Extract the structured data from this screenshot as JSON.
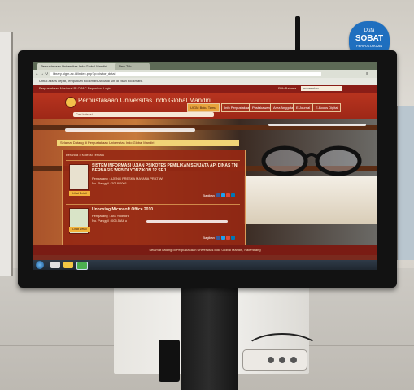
{
  "badge": {
    "line1": "Duta",
    "line2": "SOBAT",
    "line3": "PERPUSTAKAAN"
  },
  "browser": {
    "tabs": [
      "Perpustakaan Universitas Indo Global Mandiri",
      "New Tab"
    ],
    "url": "library.uigm.ac.id/index.php?p=visitor_detail",
    "bookmarks": "Untuk akses cepat, tempatkan bookmark Anda di sini di bilah bookmark."
  },
  "site": {
    "topbar": "Perpustakaan Nasional RI    OPAC    Repositori    Login",
    "title": "Perpustakaan Universitas Indo Global Mandiri",
    "language_label": "Pilih Bahasa",
    "language_value": "Indonesian",
    "menu": [
      "UIGM",
      "Buku Tamu",
      "Info Perpustakaan",
      "Pustakawan",
      "Area Anggota",
      "E-Journal",
      "E-Books Digital"
    ],
    "search_placeholder": "Cari koleksi...",
    "welcome": "Selamat Datang di Perpustakaan Universitas Indo Global Mandiri",
    "breadcrumb": "Beranda  >  Koleksi Terbaru",
    "items": [
      {
        "title": "SISTEM INFORMASI UJIAN PSIKOTES PEMILIKAN SENJATA API DINAS TNI BERBASIS WEB DI YONZIKON 12 SRJ",
        "author": "Pengarang : AJENG FRESKA MAYANA PRATIWI",
        "call_no": "No. Panggil : 2018/0001",
        "detail": "Lihat Detail",
        "share": "Bagikan"
      },
      {
        "title": "Unboxing Microsoft Office 2010",
        "author": "Pengarang : Alfa Yudistira",
        "call_no": "No. Panggil : 005.5 Alf u",
        "detail": "Lihat Detail",
        "share": "Bagikan"
      }
    ],
    "footer": "Selamat datang di Perpustakaan Universitas Indo Global Mandiri, Palembang"
  },
  "colors": {
    "brand": "#9e2817",
    "accent": "#e8a33c",
    "badge": "#1f6fbf"
  }
}
